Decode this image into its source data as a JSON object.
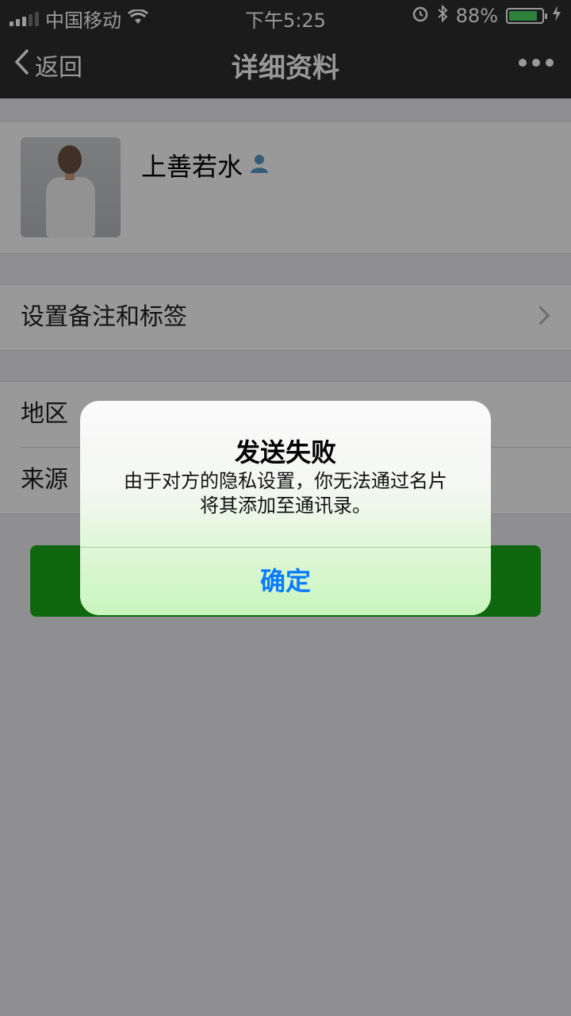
{
  "status": {
    "carrier": "中国移动",
    "time": "下午5:25",
    "battery": "88%",
    "battery_level": 0.88
  },
  "nav": {
    "back_label": "返回",
    "title": "详细资料"
  },
  "profile": {
    "name": "上善若水"
  },
  "remark_row": {
    "label": "设置备注和标签"
  },
  "info": {
    "region_label": "地区",
    "source_label": "来源"
  },
  "dialog": {
    "title": "发送失败",
    "message_line1": "由于对方的隐私设置，你无法通过名片",
    "message_line2": "将其添加至通讯录。",
    "ok_label": "确定"
  },
  "colors": {
    "nav_bg": "#2e2e2e",
    "primary_green": "#1aad19",
    "ios_blue": "#0a7aff"
  }
}
